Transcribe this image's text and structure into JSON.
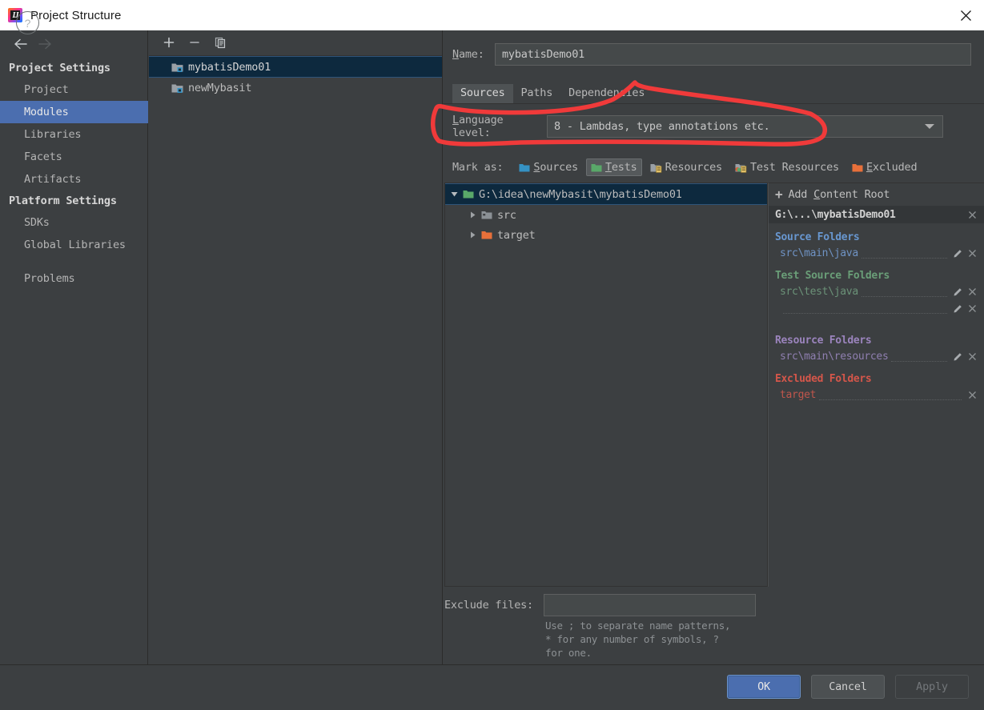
{
  "window": {
    "title": "Project Structure",
    "logo_icon": "intellij-idea-logo",
    "close_icon": "close-icon"
  },
  "nav": {
    "back_icon": "arrow-left-icon",
    "forward_icon": "arrow-right-icon"
  },
  "sidebar": {
    "groups": [
      {
        "label": "Project Settings",
        "items": [
          {
            "label": "Project",
            "selected": false
          },
          {
            "label": "Modules",
            "selected": true
          },
          {
            "label": "Libraries",
            "selected": false
          },
          {
            "label": "Facets",
            "selected": false
          },
          {
            "label": "Artifacts",
            "selected": false
          }
        ]
      },
      {
        "label": "Platform Settings",
        "items": [
          {
            "label": "SDKs",
            "selected": false
          },
          {
            "label": "Global Libraries",
            "selected": false
          }
        ]
      }
    ],
    "extra": [
      {
        "label": "Problems",
        "selected": false
      }
    ]
  },
  "module_panel": {
    "toolbar": [
      {
        "name": "add-module-button",
        "icon": "plus-icon"
      },
      {
        "name": "remove-module-button",
        "icon": "minus-icon"
      },
      {
        "name": "copy-module-button",
        "icon": "copy-icon"
      }
    ],
    "modules": [
      {
        "label": "mybatisDemo01",
        "selected": true,
        "icon": "module-folder-icon"
      },
      {
        "label": "newMybasit",
        "selected": false,
        "icon": "module-folder-icon"
      }
    ]
  },
  "detail": {
    "name_label": "Name:",
    "name_value": "mybatisDemo01",
    "tabs": [
      {
        "label": "Sources",
        "active": true
      },
      {
        "label": "Paths",
        "active": false
      },
      {
        "label": "Dependencies",
        "active": false
      }
    ],
    "language_level": {
      "label": "Language level:",
      "value": "8 - Lambdas, type annotations etc.",
      "caret_icon": "chevron-down-icon"
    },
    "mark_as": {
      "label": "Mark as:",
      "options": [
        {
          "label": "Sources",
          "mnemonic": "S",
          "icon": "sources-folder-icon",
          "color": "#3592c4",
          "active": false
        },
        {
          "label": "Tests",
          "mnemonic": "T",
          "icon": "tests-folder-icon",
          "color": "#62b543",
          "active": true
        },
        {
          "label": "Resources",
          "mnemonic": "",
          "icon": "resources-folder-icon",
          "color": "#a8adb2",
          "active": false
        },
        {
          "label": "Test Resources",
          "mnemonic": "",
          "icon": "test-resources-folder-icon",
          "color": "#a8adb2",
          "active": false
        },
        {
          "label": "Excluded",
          "mnemonic": "E",
          "icon": "excluded-folder-icon",
          "color": "#e8703a",
          "active": false
        }
      ]
    },
    "tree": [
      {
        "label": "G:\\idea\\newMybasit\\mybatisDemo01",
        "depth": 0,
        "expanded": true,
        "icon": "green-folder-icon",
        "selected": true
      },
      {
        "label": "src",
        "depth": 1,
        "expanded": false,
        "icon": "grey-folder-icon",
        "selected": false
      },
      {
        "label": "target",
        "depth": 1,
        "expanded": false,
        "icon": "orange-folder-icon",
        "selected": false
      }
    ],
    "exclude_files": {
      "label": "Exclude files:",
      "value": "",
      "placeholder": "",
      "hint": "Use ; to separate name patterns,\n* for any number of symbols, ?\nfor one."
    }
  },
  "content_roots": {
    "add_label": "Add Content Root",
    "add_mnemonic": "C",
    "add_icon": "plus-icon",
    "root_header": {
      "label": "G:\\...\\mybatisDemo01",
      "close_icon": "close-icon"
    },
    "sections": [
      {
        "title": "Source Folders",
        "kind": "src",
        "color": "#6897d0",
        "paths": [
          {
            "label": "src\\main\\java",
            "edit_icon": "pencil-icon",
            "remove_icon": "close-icon"
          }
        ]
      },
      {
        "title": "Test Source Folders",
        "kind": "test",
        "color": "#6a9e78",
        "paths": [
          {
            "label": "src\\test\\java",
            "edit_icon": "pencil-icon",
            "remove_icon": "close-icon"
          },
          {
            "label": "",
            "edit_icon": "pencil-icon",
            "remove_icon": "close-icon"
          }
        ]
      },
      {
        "title": "Resource Folders",
        "kind": "res",
        "color": "#9b84bd",
        "paths": [
          {
            "label": "src\\main\\resources",
            "edit_icon": "pencil-icon",
            "remove_icon": "close-icon"
          }
        ]
      },
      {
        "title": "Excluded Folders",
        "kind": "exc",
        "color": "#d4564a",
        "paths": [
          {
            "label": "target",
            "edit_icon": "",
            "remove_icon": "close-icon"
          }
        ]
      }
    ]
  },
  "footer": {
    "help_label": "?",
    "ok_label": "OK",
    "cancel_label": "Cancel",
    "apply_label": "Apply"
  },
  "annotation": {
    "color": "#f03a3a",
    "description": "hand-drawn red circle around Language level row"
  }
}
